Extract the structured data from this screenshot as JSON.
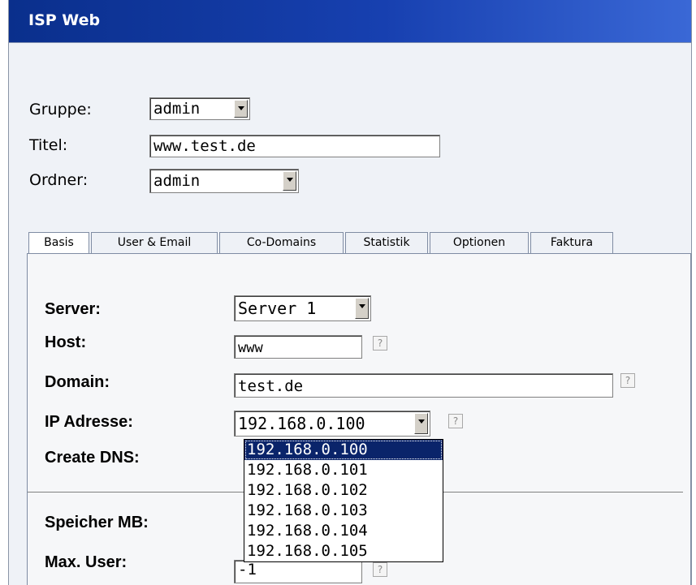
{
  "window": {
    "title": "ISP Web"
  },
  "form": {
    "gruppe": {
      "label": "Gruppe:",
      "value": "admin"
    },
    "titel": {
      "label": "Titel:",
      "value": "www.test.de"
    },
    "ordner": {
      "label": "Ordner:",
      "value": "admin"
    }
  },
  "tabs": [
    {
      "label": "Basis",
      "active": true
    },
    {
      "label": "User & Email"
    },
    {
      "label": "Co-Domains"
    },
    {
      "label": "Statistik"
    },
    {
      "label": "Optionen"
    },
    {
      "label": "Faktura"
    }
  ],
  "basis": {
    "server": {
      "label": "Server:",
      "value": "Server 1"
    },
    "host": {
      "label": "Host:",
      "value": "www"
    },
    "domain": {
      "label": "Domain:",
      "value": "test.de"
    },
    "ip": {
      "label": "IP Adresse:",
      "value": "192.168.0.100",
      "options": [
        "192.168.0.100",
        "192.168.0.101",
        "192.168.0.102",
        "192.168.0.103",
        "192.168.0.104",
        "192.168.0.105"
      ],
      "highlighted": "192.168.0.100"
    },
    "create_dns": {
      "label": "Create DNS:"
    },
    "speicher": {
      "label": "Speicher MB:"
    },
    "max_user": {
      "label": "Max. User:",
      "value": "-1"
    }
  },
  "help": {
    "symbol": "?"
  }
}
